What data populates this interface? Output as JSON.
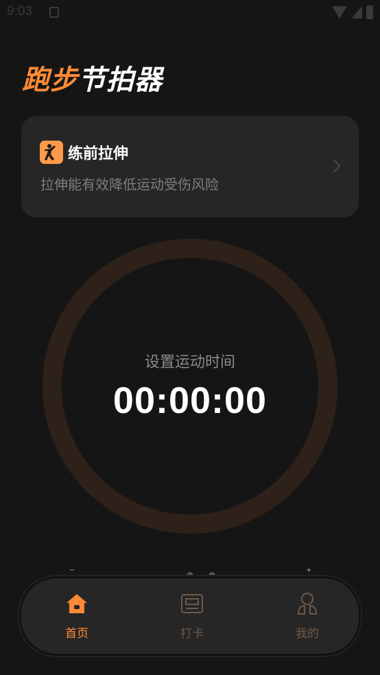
{
  "status_bar": {
    "time": "9:03"
  },
  "header": {
    "title_accent": "跑步",
    "title_rest": "节拍器"
  },
  "stretch_card": {
    "title": "练前拉伸",
    "description": "拉伸能有效降低运动受伤风险"
  },
  "timer": {
    "caption": "设置运动时间",
    "value": "00:00:00"
  },
  "tab_bar": {
    "tabs": [
      {
        "label": "首页",
        "icon": "home-icon",
        "active": true
      },
      {
        "label": "打卡",
        "icon": "checkin-icon",
        "active": false
      },
      {
        "label": "我的",
        "icon": "profile-icon",
        "active": false
      }
    ]
  },
  "colors": {
    "accent": "#ff8a35",
    "background": "#151515",
    "card": "#262626",
    "ring": "#2d2119"
  }
}
